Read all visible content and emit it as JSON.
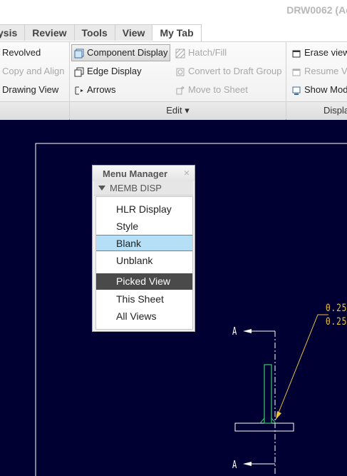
{
  "window": {
    "title": "DRW0062 (Ac"
  },
  "tabs": [
    "ysis",
    "Review",
    "Tools",
    "View",
    "My Tab"
  ],
  "ribbon": {
    "col1": [
      "Revolved",
      "Copy and Align",
      "Drawing View"
    ],
    "col2": [
      "Component Display",
      "Edge Display",
      "Arrows"
    ],
    "col3": [
      "Hatch/Fill",
      "Convert to Draft Group",
      "Move to Sheet"
    ],
    "col4": [
      "Erase view",
      "Resume V",
      "Show Mod"
    ],
    "groups": {
      "edit": "Edit ▾",
      "display": "Displa"
    }
  },
  "menu_manager": {
    "title": "Menu Manager",
    "close": "×",
    "section": "MEMB DISP",
    "items": [
      "HLR Display",
      "Style",
      "Blank",
      "Unblank",
      "Picked View",
      "This Sheet",
      "All Views"
    ]
  },
  "drawing": {
    "section_label_top": "A",
    "section_label_bottom": "A",
    "dim_1": "0.25",
    "dim_2": "0.25"
  },
  "colors": {
    "canvas_bg": "#000033",
    "highlight": "#b5dff7",
    "picked": "#4a4a4a",
    "dimension": "#e8c040"
  }
}
